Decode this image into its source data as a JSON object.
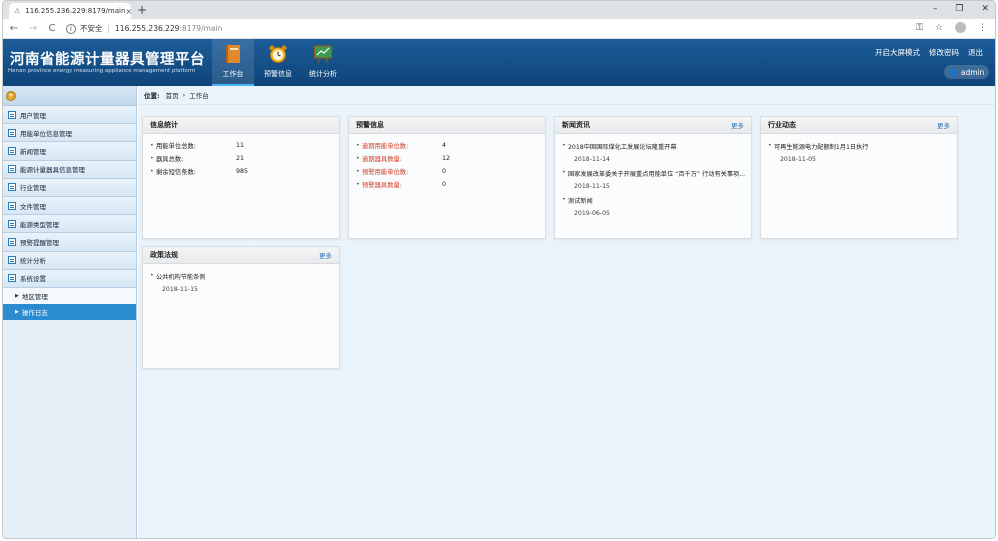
{
  "browser": {
    "tab_title": "116.255.236.229:8179/main",
    "tab_close": "×",
    "new_tab": "+",
    "back": "←",
    "forward": "→",
    "reload": "C",
    "security_label": "不安全",
    "url_host": "116.255.236.229",
    "url_path": ":8179/main",
    "key_icon": "⚿",
    "star_icon": "☆",
    "menu_icon": "⋮",
    "minimize": "–",
    "maximize": "❐",
    "close": "✕"
  },
  "header": {
    "title": "河南省能源计量器具管理平台",
    "subtitle": "Henan province energy measuring appliance management platform",
    "nav": [
      {
        "label": "工作台"
      },
      {
        "label": "预警信息"
      },
      {
        "label": "统计分析"
      }
    ],
    "links": [
      "开启大屏模式",
      "修改密码",
      "退出"
    ],
    "user": "admin"
  },
  "sidebar": {
    "items": [
      {
        "label": "用户管理"
      },
      {
        "label": "用能单位信息管理"
      },
      {
        "label": "新闻管理"
      },
      {
        "label": "能源计量器具信息管理"
      },
      {
        "label": "行业管理"
      },
      {
        "label": "文件管理"
      },
      {
        "label": "能源类型管理"
      },
      {
        "label": "预警提醒管理"
      },
      {
        "label": "统计分析"
      },
      {
        "label": "系统设置"
      }
    ],
    "subitems": [
      {
        "label": "地区管理"
      },
      {
        "label": "操作日志"
      }
    ]
  },
  "breadcrumb": {
    "label": "位置:",
    "home": "首页",
    "sep": "›",
    "current": "工作台"
  },
  "cards": {
    "info": {
      "title": "信息统计",
      "rows": [
        {
          "k": "用能单位总数:",
          "v": "11"
        },
        {
          "k": "器具总数:",
          "v": "21"
        },
        {
          "k": "剩余短信条数:",
          "v": "985"
        }
      ]
    },
    "alert": {
      "title": "预警信息",
      "rows": [
        {
          "k": "逾期用能单位数:",
          "v": "4"
        },
        {
          "k": "逾期器具数量:",
          "v": "12"
        },
        {
          "k": "预警用能单位数:",
          "v": "0"
        },
        {
          "k": "预警器具数量:",
          "v": "0"
        }
      ]
    },
    "news": {
      "title": "新闻资讯",
      "more": "更多",
      "items": [
        {
          "title": "2018中国国际煤化工发展论坛隆重开幕",
          "date": "2018-11-14"
        },
        {
          "title": "国家发展改革委关于开展重点用能单位 “百千万” 行动有关事项...",
          "date": "2018-11-15"
        },
        {
          "title": "测试新闻",
          "date": "2019-06-05"
        }
      ]
    },
    "industry": {
      "title": "行业动态",
      "more": "更多",
      "items": [
        {
          "title": "可再生能源电力配额制1月1日执行",
          "date": "2018-11-05"
        }
      ]
    },
    "policy": {
      "title": "政策法规",
      "more": "更多",
      "items": [
        {
          "title": "公共机构节能条例",
          "date": "2018-11-15"
        }
      ]
    }
  },
  "colors": {
    "header_bg": "#1a5a96",
    "accent": "#2b8bd0",
    "warn": "#d23b25"
  }
}
